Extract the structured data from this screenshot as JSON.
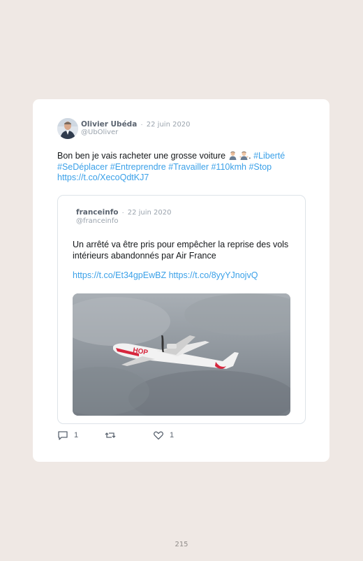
{
  "tweet": {
    "author_name": "Olivier Ubéda",
    "separator": "·",
    "date": "22 juin 2020",
    "handle": "@UbOliver",
    "text_before": "Bon ben je vais racheter une grosse voiture",
    "text_after_emoji": ".",
    "hashtags_line1": "#Liberté",
    "hashtags_line2": "#SeDéplacer #Entreprendre #Travailler #110kmh #Stop",
    "link": "https://t.co/XecoQdtKJ7",
    "emoji_icons": [
      "man-facepalming-icon",
      "man-shrugging-icon"
    ]
  },
  "quoted_tweet": {
    "author_name": "franceinfo",
    "separator": "·",
    "date": "22 juin 2020",
    "handle": "@franceinfo",
    "text": "Un arrêté va être pris pour empêcher la reprise des vols intérieurs abandonnés par Air France",
    "link1": "https://t.co/Et34gpEwBZ",
    "link2": "https://t.co/8yyYJnojvQ",
    "image": "hop-airplane-photo"
  },
  "actions": {
    "reply_count": "1",
    "retweet_count": "",
    "like_count": "1"
  },
  "page_number": "215",
  "colors": {
    "background": "#efe8e4",
    "card": "#ffffff",
    "link": "#3aa0e8",
    "muted": "#9aa3ad"
  }
}
